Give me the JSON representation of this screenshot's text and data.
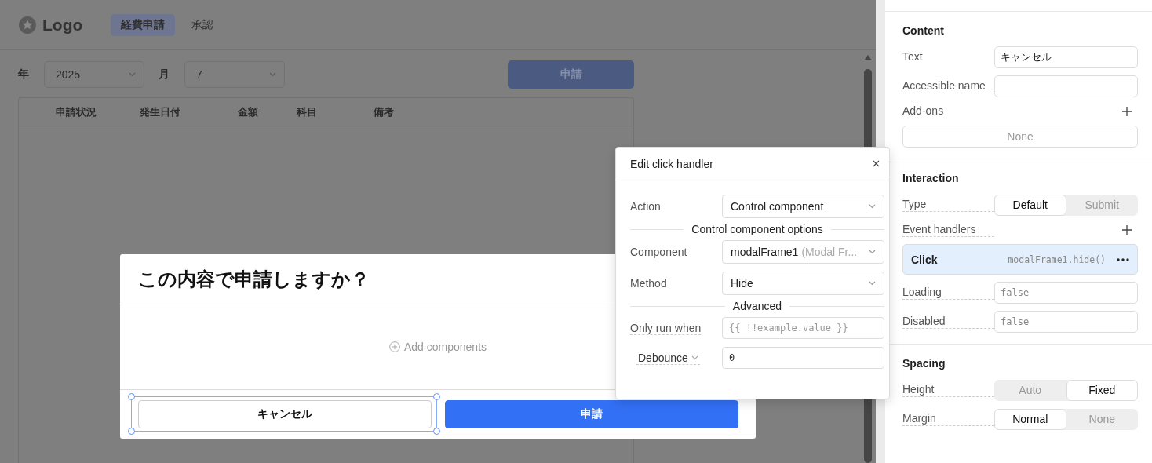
{
  "app": {
    "logo": "Logo",
    "tabs": [
      {
        "label": "経費申請",
        "selected": true
      },
      {
        "label": "承認",
        "selected": false
      }
    ],
    "filters": [
      {
        "label": "年",
        "value": "2025"
      },
      {
        "label": "月",
        "value": "7"
      }
    ],
    "apply_button": "申請",
    "table": {
      "columns": [
        "申請状況",
        "発生日付",
        "金額",
        "科目",
        "備考"
      ]
    }
  },
  "modal": {
    "title": "この内容で申請しますか？",
    "placeholder": "Add components",
    "buttons": [
      {
        "label": "キャンセル",
        "kind": "secondary",
        "selected": true
      },
      {
        "label": "申請",
        "kind": "primary",
        "selected": false
      }
    ]
  },
  "popover": {
    "title": "Edit click handler",
    "fields": [
      {
        "kind": "select",
        "label": "Action",
        "value": "Control component"
      },
      {
        "kind": "divider",
        "label": "Control component options"
      },
      {
        "kind": "select",
        "label": "Component",
        "value": "modalFrame1",
        "hint": "(Modal Fr..."
      },
      {
        "kind": "select",
        "label": "Method",
        "value": "Hide"
      },
      {
        "kind": "divider",
        "label": "Advanced"
      },
      {
        "kind": "input",
        "label": "Only run when",
        "placeholder": "{{ !!example.value }}"
      },
      {
        "kind": "dropdown-input",
        "label": "Debounce",
        "value": "0"
      }
    ]
  },
  "panel": {
    "sections": [
      {
        "title": "Content",
        "rows": [
          {
            "kind": "input",
            "label": "Text",
            "value": "キャンセル",
            "underlined": false
          },
          {
            "kind": "input",
            "label": "Accessible name",
            "value": "",
            "underlined": true
          },
          {
            "kind": "list",
            "label": "Add-ons",
            "underlined": false,
            "items": [
              {
                "kind": "empty",
                "label": "None"
              }
            ]
          }
        ]
      },
      {
        "title": "Interaction",
        "rows": [
          {
            "kind": "segmented",
            "label": "Type",
            "underlined": true,
            "options": [
              {
                "label": "Default",
                "selected": true
              },
              {
                "label": "Submit",
                "selected": false
              }
            ]
          },
          {
            "kind": "list",
            "label": "Event handlers",
            "underlined": true,
            "items": [
              {
                "kind": "handler",
                "label": "Click",
                "code": "modalFrame1.hide()",
                "selected": true
              }
            ]
          },
          {
            "kind": "code",
            "label": "Loading",
            "value": "false",
            "underlined": true
          },
          {
            "kind": "code",
            "label": "Disabled",
            "value": "false",
            "underlined": true
          }
        ]
      },
      {
        "title": "Spacing",
        "rows": [
          {
            "kind": "segmented",
            "label": "Height",
            "underlined": true,
            "options": [
              {
                "label": "Auto",
                "selected": false
              },
              {
                "label": "Fixed",
                "selected": true
              }
            ]
          },
          {
            "kind": "segmented",
            "label": "Margin",
            "underlined": true,
            "options": [
              {
                "label": "Normal",
                "selected": true
              },
              {
                "label": "None",
                "selected": false
              }
            ]
          }
        ]
      }
    ]
  }
}
